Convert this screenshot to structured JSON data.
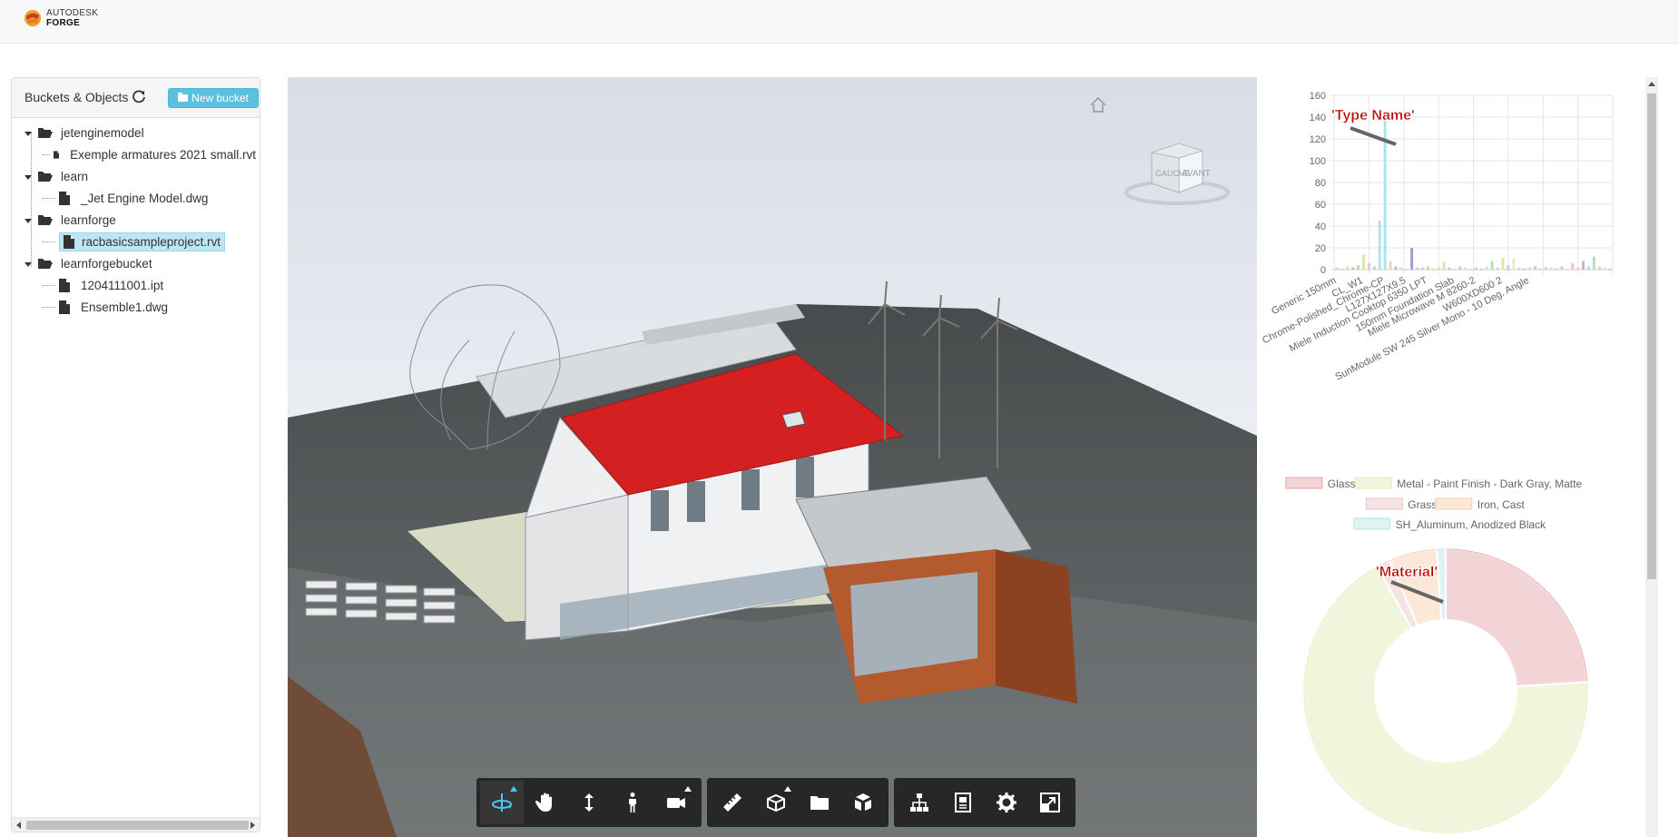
{
  "brand": {
    "line1": "AUTODESK",
    "line2": "FORGE"
  },
  "panel": {
    "title": "Buckets & Objects",
    "new_bucket_label": "New bucket",
    "buckets": [
      {
        "name": "jetenginemodel",
        "files": [
          "Exemple armatures 2021 small.rvt"
        ]
      },
      {
        "name": "learn",
        "files": [
          "_Jet Engine Model.dwg"
        ]
      },
      {
        "name": "learnforge",
        "files": [
          "racbasicsampleproject.rvt"
        ]
      },
      {
        "name": "learnforgebucket",
        "files": [
          "1204111001.ipt",
          "Ensemble1.dwg"
        ]
      }
    ],
    "selected_file": "racbasicsampleproject.rvt"
  },
  "viewer": {
    "viewcube_faces": {
      "left": "GAUCHE",
      "front": "AVANT"
    },
    "toolbar": [
      [
        "orbit-icon",
        "pan-icon",
        "dolly-icon",
        "walk-icon",
        "camera-icon"
      ],
      [
        "measure-icon",
        "section-icon",
        "explode-icon",
        "model-icon"
      ],
      [
        "structure-icon",
        "properties-icon",
        "settings-icon",
        "fullscreen-icon"
      ]
    ]
  },
  "annotations": {
    "type_name": "'Type Name'",
    "material": "'Material'"
  },
  "colors": {
    "roof": "#d42020",
    "accent": "#5bc0de",
    "selected": "#bee5f3"
  },
  "chart_data": [
    {
      "type": "bar",
      "title": "",
      "ylim": [
        0,
        160
      ],
      "yticks": [
        0,
        20,
        40,
        60,
        80,
        100,
        120,
        140,
        160
      ],
      "tick_labels": [
        "Generic 150mm",
        "CL_W1",
        "Chrome-Polished_Chrome-CP",
        "L127X127X9.5",
        "Miele Induction Cooktop 6350 LPT",
        "150mm Foundation Slab",
        "Miele Microwave M 8260-2",
        "W600XD600 2",
        "SunModule SW 245 Silver Mono - 10 Deg. Angle"
      ],
      "bars": [
        {
          "v": 2,
          "c": "#f5c2c7"
        },
        {
          "v": 1,
          "c": "#b4e0b4"
        },
        {
          "v": 3,
          "c": "#e8e0a0"
        },
        {
          "v": 2,
          "c": "#c7b7e8"
        },
        {
          "v": 4,
          "c": "#b4e0b4"
        },
        {
          "v": 14,
          "c": "#d8e8a8"
        },
        {
          "v": 6,
          "c": "#f5c2c7"
        },
        {
          "v": 3,
          "c": "#b8d0f0"
        },
        {
          "v": 45,
          "c": "#b8e0e8"
        },
        {
          "v": 143,
          "c": "#a8e4ec"
        },
        {
          "v": 8,
          "c": "#f5d0b8"
        },
        {
          "v": 3,
          "c": "#c7b7e8"
        },
        {
          "v": 2,
          "c": "#d8e8a8"
        },
        {
          "v": 1,
          "c": "#f5c2c7"
        },
        {
          "v": 20,
          "c": "#a0a0c8"
        },
        {
          "v": 2,
          "c": "#b8d0f0"
        },
        {
          "v": 2,
          "c": "#e8c0e0"
        },
        {
          "v": 3,
          "c": "#b4e0b4"
        },
        {
          "v": 1,
          "c": "#f5c2c7"
        },
        {
          "v": 2,
          "c": "#e8e0a0"
        },
        {
          "v": 7,
          "c": "#d8e8a8"
        },
        {
          "v": 2,
          "c": "#c7b7e8"
        },
        {
          "v": 1,
          "c": "#f5d0b8"
        },
        {
          "v": 3,
          "c": "#b8d0f0"
        },
        {
          "v": 2,
          "c": "#e8e0a0"
        },
        {
          "v": 1,
          "c": "#f5c2c7"
        },
        {
          "v": 2,
          "c": "#b4e0b4"
        },
        {
          "v": 1,
          "c": "#c7b7e8"
        },
        {
          "v": 3,
          "c": "#d8e8a8"
        },
        {
          "v": 8,
          "c": "#b4e0b4"
        },
        {
          "v": 2,
          "c": "#f5c2c7"
        },
        {
          "v": 11,
          "c": "#d8e8a8"
        },
        {
          "v": 4,
          "c": "#b8d0f0"
        },
        {
          "v": 10,
          "c": "#e0f0c0"
        },
        {
          "v": 2,
          "c": "#f5d0b8"
        },
        {
          "v": 1,
          "c": "#c7b7e8"
        },
        {
          "v": 2,
          "c": "#e8e0a0"
        },
        {
          "v": 3,
          "c": "#b8d0f0"
        },
        {
          "v": 1,
          "c": "#f5c2c7"
        },
        {
          "v": 2,
          "c": "#b4e0b4"
        },
        {
          "v": 2,
          "c": "#d8e8a8"
        },
        {
          "v": 1,
          "c": "#c7b7e8"
        },
        {
          "v": 3,
          "c": "#b8d0f0"
        },
        {
          "v": 1,
          "c": "#f5d0b8"
        },
        {
          "v": 6,
          "c": "#e8c0e0"
        },
        {
          "v": 2,
          "c": "#f5c2c7"
        },
        {
          "v": 8,
          "c": "#c8b0d8"
        },
        {
          "v": 3,
          "c": "#b8d0f0"
        },
        {
          "v": 12,
          "c": "#b4e0b4"
        },
        {
          "v": 3,
          "c": "#f5c2c7"
        },
        {
          "v": 2,
          "c": "#d8e8a8"
        },
        {
          "v": 1,
          "c": "#c7b7e8"
        }
      ]
    },
    {
      "type": "pie",
      "donut": true,
      "legend": [
        {
          "name": "Glass",
          "color": "#f2d4d7",
          "border": "#e8a6ae"
        },
        {
          "name": "Metal - Paint Finish - Dark Gray, Matte",
          "color": "#f0f6dc",
          "border": "#e2ecb8"
        },
        {
          "name": "Grass",
          "color": "#f5e2e4",
          "border": "#ecc2c8"
        },
        {
          "name": "Iron, Cast",
          "color": "#fbe8d8",
          "border": "#f5cfaf"
        },
        {
          "name": "SH_Aluminum, Anodized Black",
          "color": "#dff3f5",
          "border": "#b4e6ec"
        }
      ],
      "slices": [
        {
          "name": "Glass",
          "value": 24
        },
        {
          "name": "Metal - Paint Finish - Dark Gray, Matte",
          "value": 68
        },
        {
          "name": "Grass",
          "value": 1.5
        },
        {
          "name": "Iron, Cast",
          "value": 5.5
        },
        {
          "name": "SH_Aluminum, Anodized Black",
          "value": 1
        }
      ]
    }
  ]
}
